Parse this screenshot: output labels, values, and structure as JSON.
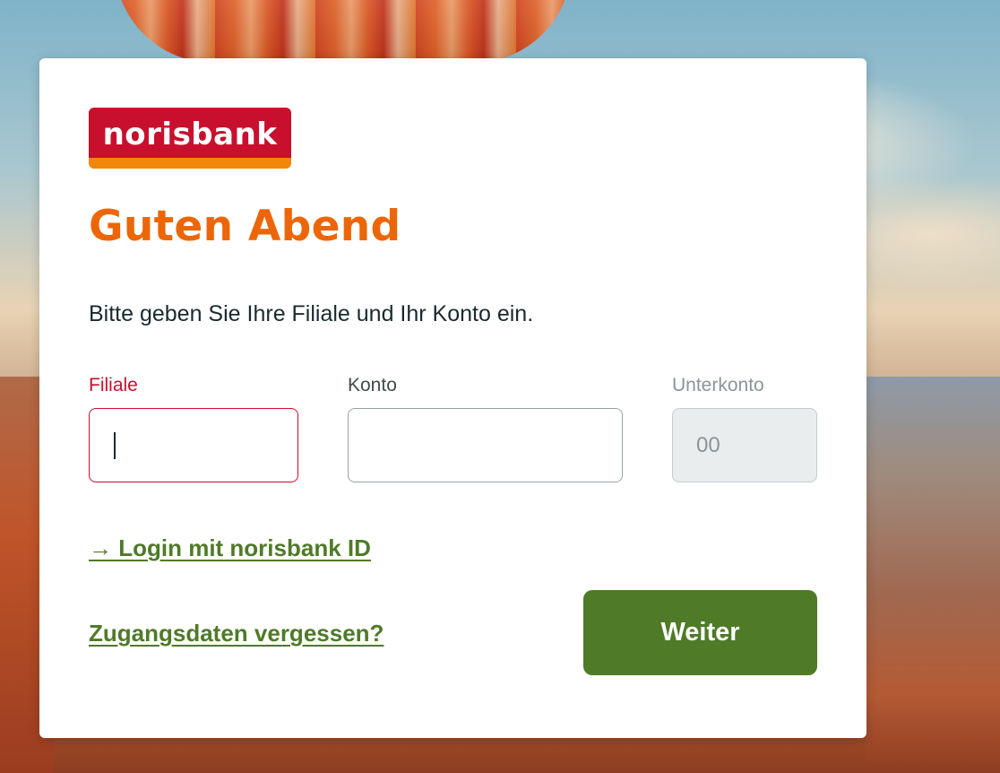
{
  "brand": {
    "logo_text": "norisbank",
    "primary_color": "#c8102e",
    "accent_color": "#f0870a"
  },
  "login": {
    "greeting": "Guten Abend",
    "instructions": "Bitte geben Sie Ihre Filiale und Ihr Konto ein.",
    "fields": {
      "filiale": {
        "label": "Filiale",
        "value": "",
        "placeholder": ""
      },
      "konto": {
        "label": "Konto",
        "value": "",
        "placeholder": ""
      },
      "unterkonto": {
        "label": "Unterkonto",
        "value": "",
        "placeholder": "00"
      }
    },
    "login_id_link": "→ Login mit norisbank ID",
    "forgot_link": "Zugangsdaten vergessen?",
    "submit_label": "Weiter"
  },
  "colors": {
    "greeting": "#ec6608",
    "link": "#4f7a28",
    "button": "#4f7a28",
    "active_field_border": "#c8102e"
  }
}
